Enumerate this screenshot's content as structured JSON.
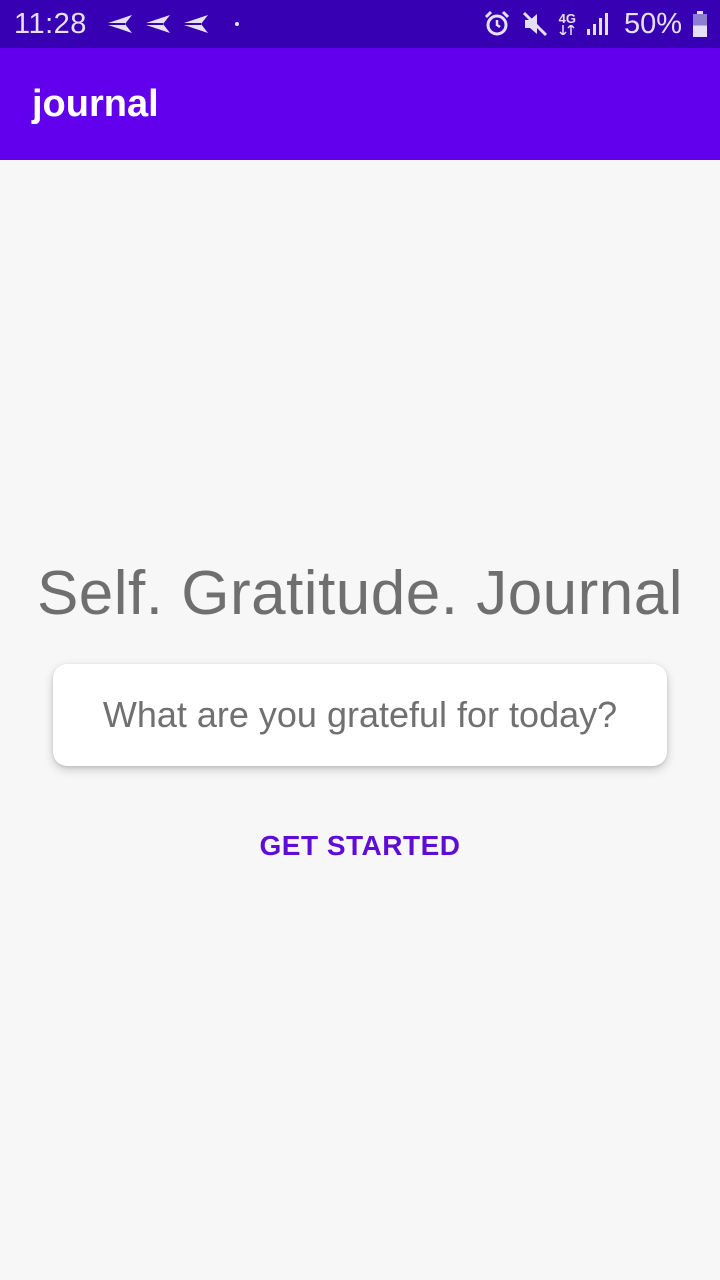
{
  "status_bar": {
    "time": "11:28",
    "left_icons": [
      "send-icon",
      "send-icon",
      "send-icon",
      "notification-dot-icon"
    ],
    "right_icons": [
      "alarm-icon",
      "mute-icon",
      "network-4g-icon",
      "signal-icon",
      "battery-icon"
    ],
    "network_label": "4G",
    "battery_percent": "50%",
    "battery_level": 0.5,
    "background": "#3700b3"
  },
  "app_bar": {
    "title": "journal",
    "background": "#6200ee"
  },
  "main": {
    "headline": "Self. Gratitude. Journal",
    "prompt": "What are you grateful for today?",
    "get_started_label": "GET STARTED"
  },
  "colors": {
    "accent": "#6200ee",
    "button_text": "#5e0cd6",
    "page_background": "#f7f7f7"
  }
}
